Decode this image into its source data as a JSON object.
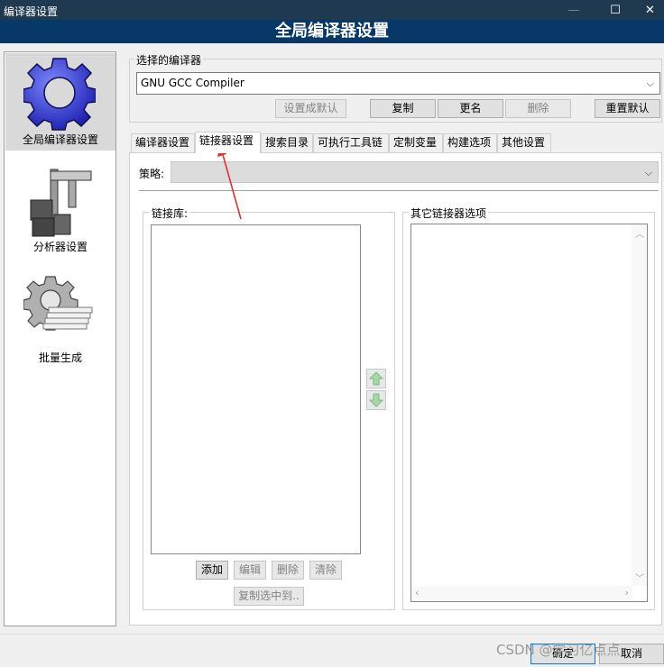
{
  "window": {
    "title": "编译器设置",
    "minimize": "—",
    "maximize": "☐",
    "close": "✕"
  },
  "banner": {
    "title": "全局编译器设置"
  },
  "nav": {
    "items": [
      {
        "label": "全局编译器设置",
        "icon": "gear-icon",
        "active": true
      },
      {
        "label": "分析器设置",
        "icon": "caliper-icon"
      },
      {
        "label": "批量生成",
        "icon": "batch-build-icon"
      }
    ]
  },
  "compiler_select": {
    "group_label": "选择的编译器",
    "value": "GNU GCC Compiler",
    "buttons": {
      "set_default": "设置成默认",
      "copy": "复制",
      "rename": "更名",
      "delete": "删除",
      "reset_defaults": "重置默认"
    }
  },
  "tabs": [
    "编译器设置",
    "链接器设置",
    "搜索目录",
    "可执行工具链",
    "定制变量",
    "构建选项",
    "其他设置"
  ],
  "active_tab": 1,
  "linker": {
    "policy_label": "策略:",
    "policy_value": "",
    "libs_label": "链接库:",
    "other_options_label": "其它链接器选项",
    "buttons": {
      "add": "添加",
      "edit": "编辑",
      "delete": "删除",
      "clear": "清除",
      "copy_selected_to": "复制选中到.."
    }
  },
  "footer": {
    "ok": "确定",
    "cancel": "取消",
    "watermark": "CSDN @学习亿点点"
  },
  "colors": {
    "titlebar": "#1f3a50",
    "banner": "#073868",
    "annotation_arrow": "#e03030"
  }
}
